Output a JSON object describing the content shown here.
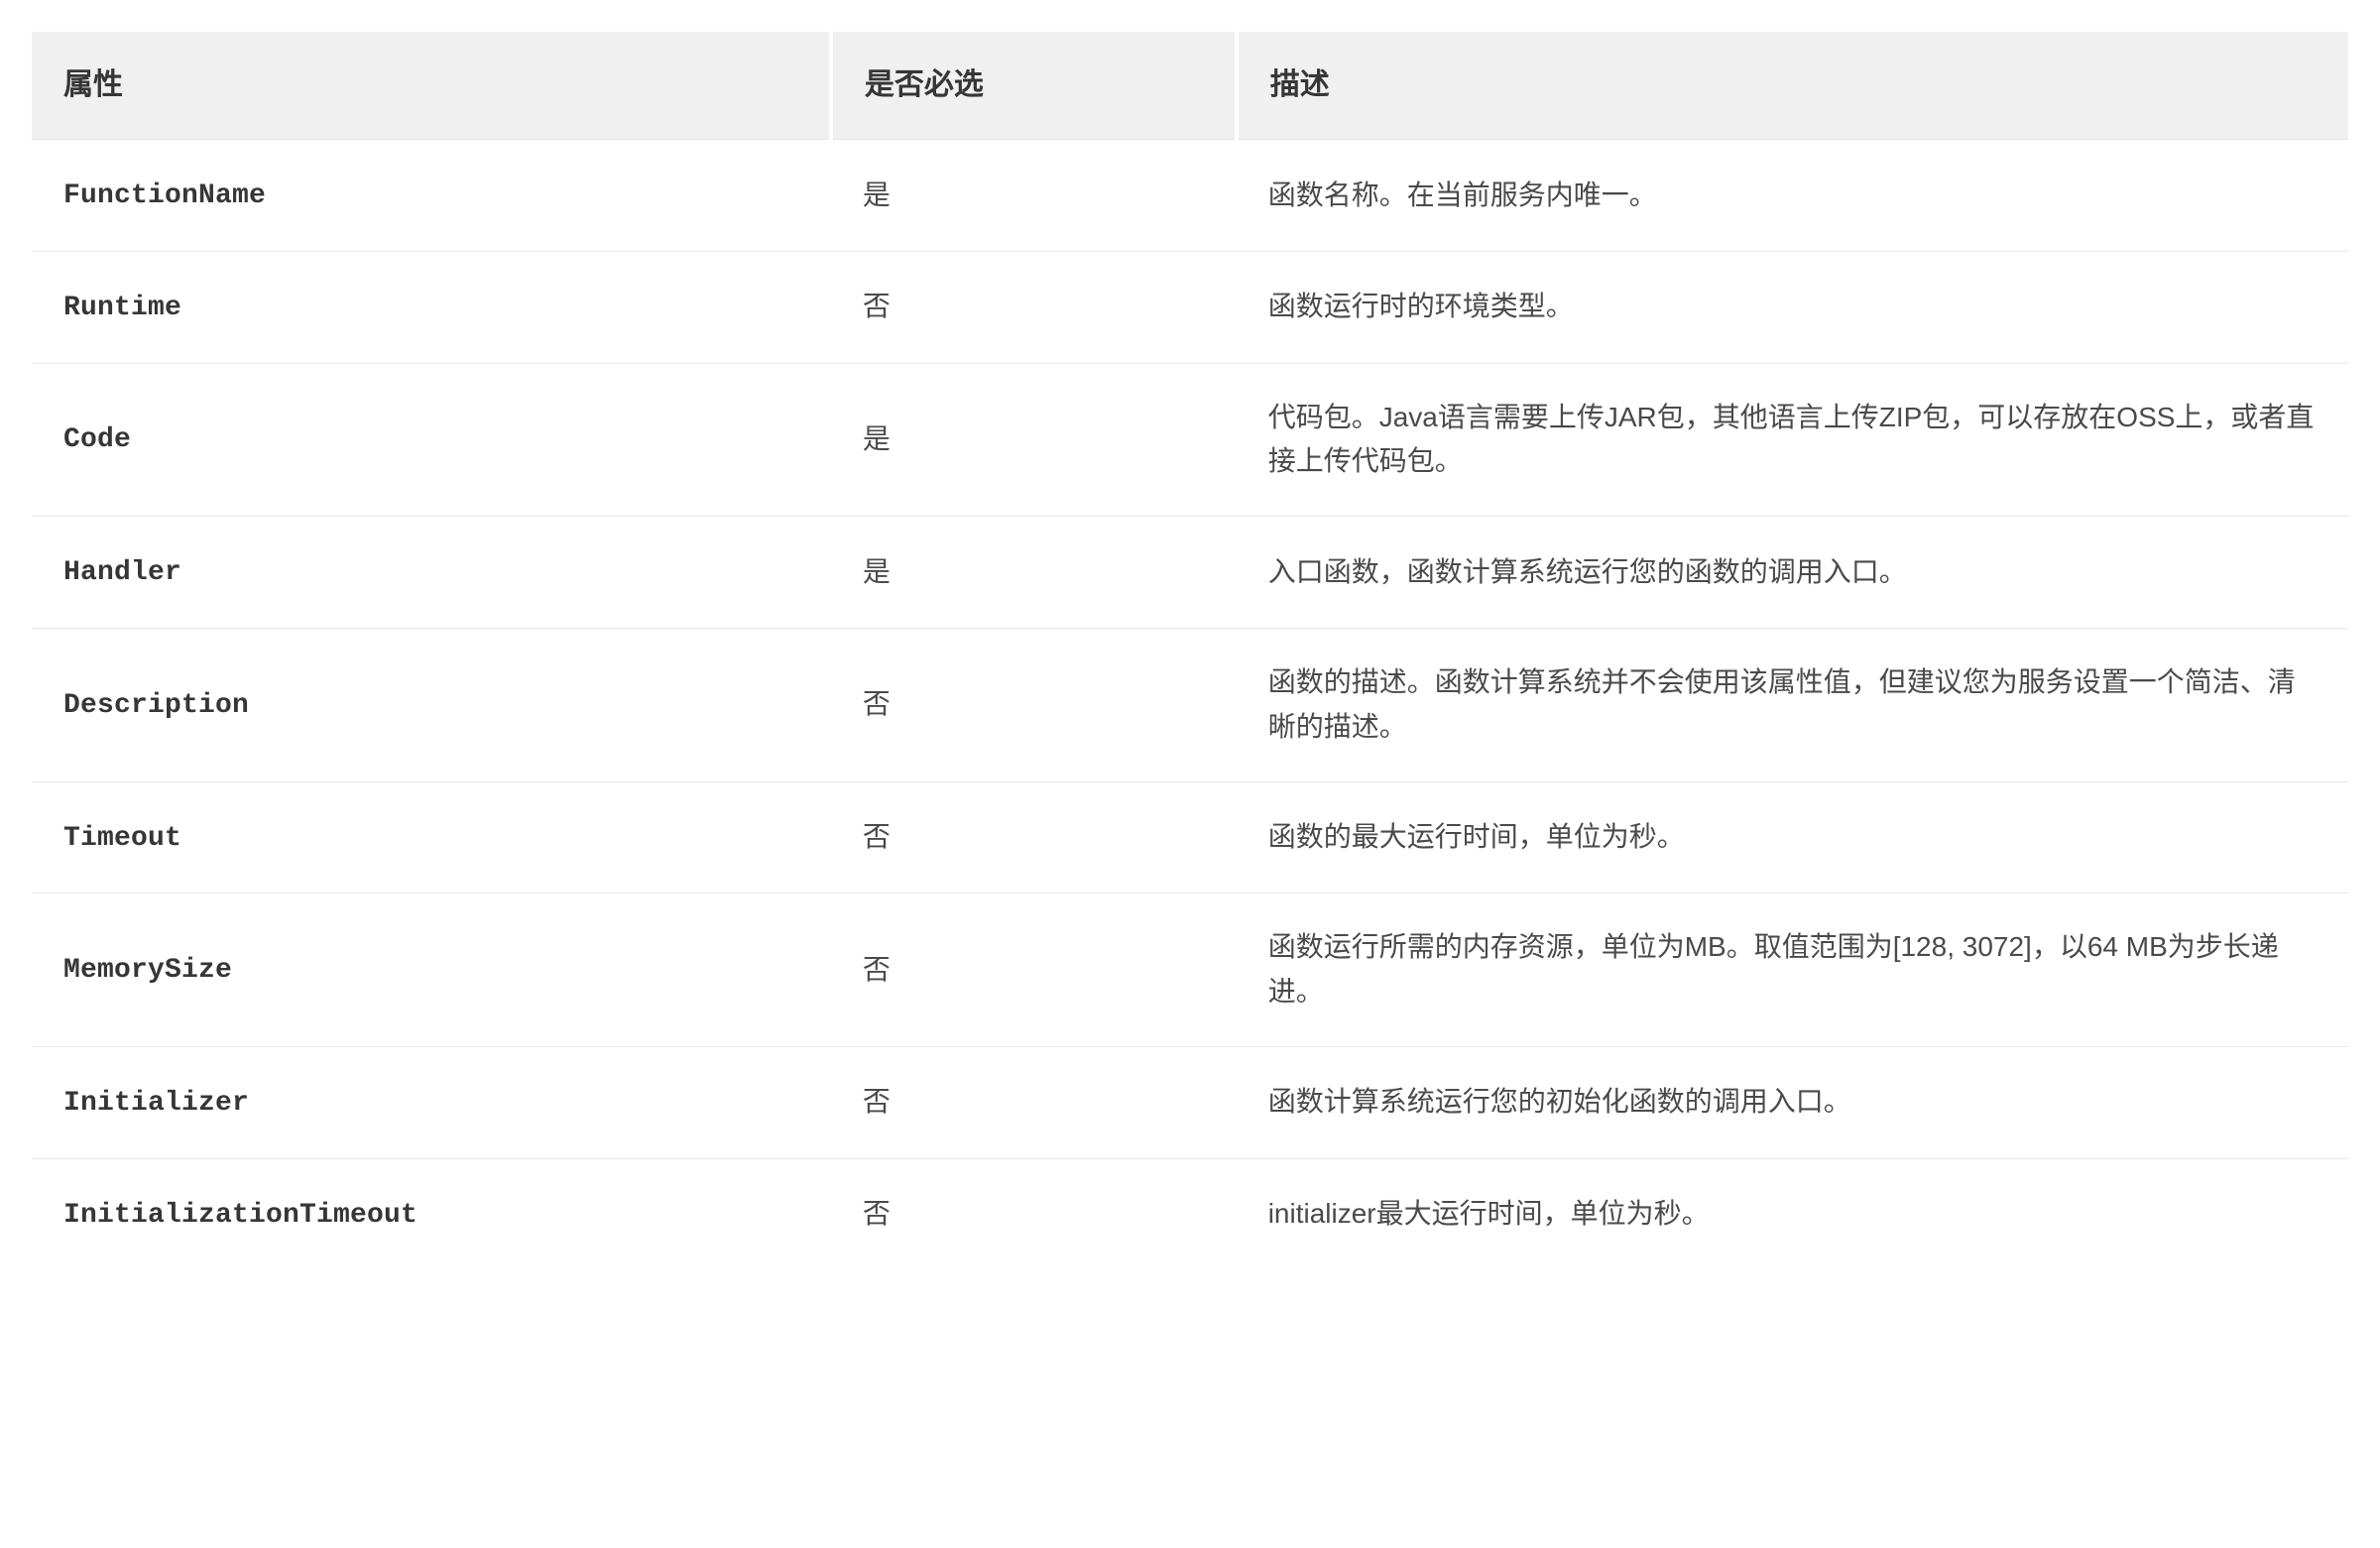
{
  "table": {
    "headers": {
      "attribute": "属性",
      "required": "是否必选",
      "description": "描述"
    },
    "rows": [
      {
        "attr": "FunctionName",
        "required": "是",
        "desc": "函数名称。在当前服务内唯一。"
      },
      {
        "attr": "Runtime",
        "required": "否",
        "desc": "函数运行时的环境类型。"
      },
      {
        "attr": "Code",
        "required": "是",
        "desc": "代码包。Java语言需要上传JAR包，其他语言上传ZIP包，可以存放在OSS上，或者直接上传代码包。"
      },
      {
        "attr": "Handler",
        "required": "是",
        "desc": "入口函数，函数计算系统运行您的函数的调用入口。"
      },
      {
        "attr": "Description",
        "required": "否",
        "desc": "函数的描述。函数计算系统并不会使用该属性值，但建议您为服务设置一个简洁、清晰的描述。"
      },
      {
        "attr": "Timeout",
        "required": "否",
        "desc": "函数的最大运行时间，单位为秒。"
      },
      {
        "attr": "MemorySize",
        "required": "否",
        "desc": "函数运行所需的内存资源，单位为MB。取值范围为[128, 3072]，以64 MB为步长递进。"
      },
      {
        "attr": "Initializer",
        "required": "否",
        "desc": "函数计算系统运行您的初始化函数的调用入口。"
      },
      {
        "attr": "InitializationTimeout",
        "required": "否",
        "desc": "initializer最大运行时间，单位为秒。"
      }
    ]
  }
}
